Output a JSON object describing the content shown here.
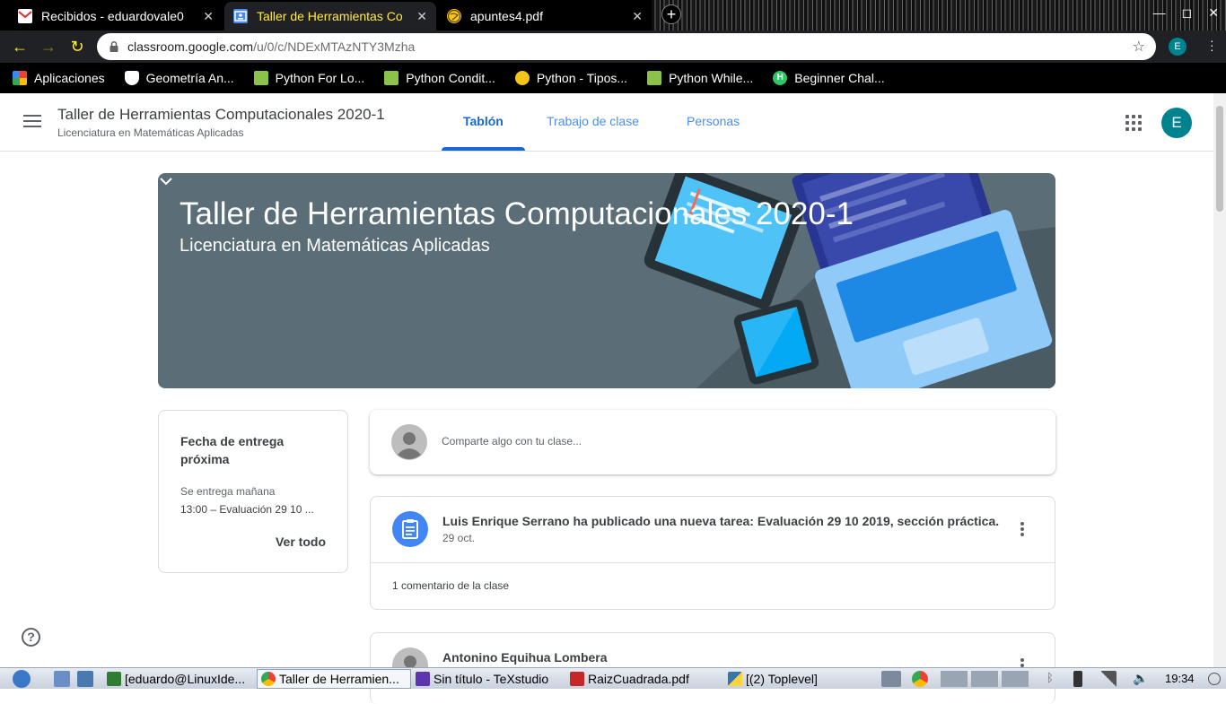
{
  "browser": {
    "tabs": [
      {
        "title": "Recibidos - eduardovale0",
        "active": false
      },
      {
        "title": "Taller de Herramientas Co",
        "active": true
      },
      {
        "title": "apuntes4.pdf",
        "active": false
      }
    ],
    "new_tab": "+",
    "url_host": "classroom.google.com",
    "url_path": "/u/0/c/NDExMTAzNTY3Mzha",
    "profile_initial": "E"
  },
  "bookmarks": [
    {
      "label": "Aplicaciones"
    },
    {
      "label": "Geometría An..."
    },
    {
      "label": "Python For Lo..."
    },
    {
      "label": "Python Condit..."
    },
    {
      "label": "Python - Tipos..."
    },
    {
      "label": "Python While..."
    },
    {
      "label": "Beginner Chal..."
    }
  ],
  "header": {
    "class_title": "Taller de Herramientas Computacionales 2020-1",
    "class_subtitle": "Licenciatura en Matemáticas Aplicadas",
    "tabs": [
      {
        "label": "Tablón",
        "active": true
      },
      {
        "label": "Trabajo de clase",
        "active": false
      },
      {
        "label": "Personas",
        "active": false
      }
    ],
    "avatar_initial": "E"
  },
  "banner": {
    "title": "Taller de Herramientas Computacionales 2020-1",
    "subtitle": "Licenciatura en Matemáticas Aplicadas"
  },
  "upcoming": {
    "title": "Fecha de entrega próxima",
    "due_label": "Se entrega mañana",
    "item": "13:00 – Evaluación 29 10 ...",
    "view_all": "Ver todo"
  },
  "share": {
    "placeholder": "Comparte algo con tu clase..."
  },
  "posts": [
    {
      "title": "Luis Enrique Serrano ha publicado una nueva tarea: Evaluación 29 10 2019, sección práctica.",
      "date": "29 oct.",
      "comments": "1 comentario de la clase"
    },
    {
      "title": "Antonino Equihua Lombera"
    }
  ],
  "help": "?",
  "taskbar": {
    "tasks": [
      {
        "label": "[eduardo@LinuxIde...",
        "active": false
      },
      {
        "label": "Taller de Herramien...",
        "active": true
      },
      {
        "label": "Sin título - TeXstudio",
        "active": false
      },
      {
        "label": "RaizCuadrada.pdf",
        "active": false
      },
      {
        "label": "[(2) Toplevel]",
        "active": false
      }
    ],
    "clock": "19:34"
  },
  "colors": {
    "accent": "#1967d2",
    "banner_bg": "#5b6e78",
    "avatar": "#00838f",
    "assignment_icon": "#4285f4"
  }
}
